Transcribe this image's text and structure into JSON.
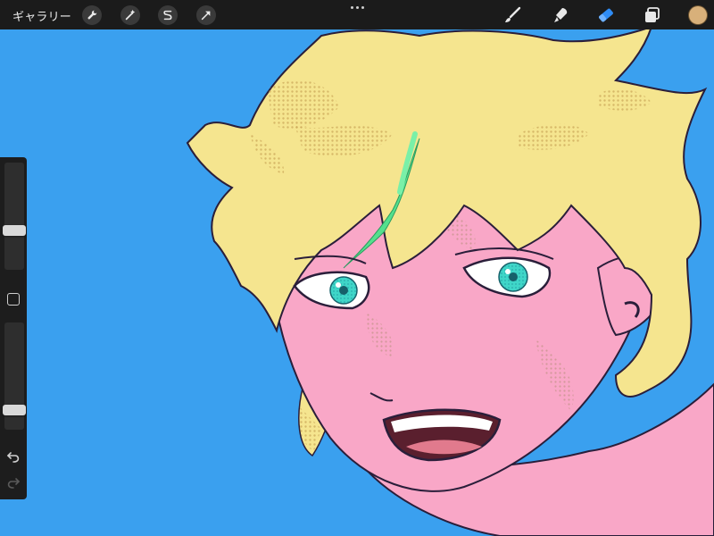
{
  "app": {
    "gallery_label": "ギャラリー"
  },
  "toolbar_left": [
    {
      "name": "actions",
      "icon": "wrench-icon"
    },
    {
      "name": "adjustments",
      "icon": "magic-wand-icon"
    },
    {
      "name": "selection",
      "icon": "selection-s-icon"
    },
    {
      "name": "transform",
      "icon": "arrow-cursor-icon"
    }
  ],
  "toolbar_right": [
    {
      "name": "brush",
      "icon": "brush-icon",
      "active": false
    },
    {
      "name": "smudge",
      "icon": "smudge-icon",
      "active": false
    },
    {
      "name": "eraser",
      "icon": "eraser-icon",
      "active": true
    },
    {
      "name": "layers",
      "icon": "layers-icon",
      "active": false
    }
  ],
  "colors": {
    "canvas_background": "#3aa0ef",
    "active_tool": "#2f8cf5",
    "current_color": "#d8b07a",
    "skin": "#f9a7c7",
    "hair": "#f5e58f",
    "hair_accent": "#55e08d",
    "eyes": "#3fd6c8"
  },
  "sidebar": {
    "brush_size_level": 0.35,
    "opacity_level": 0.15
  }
}
